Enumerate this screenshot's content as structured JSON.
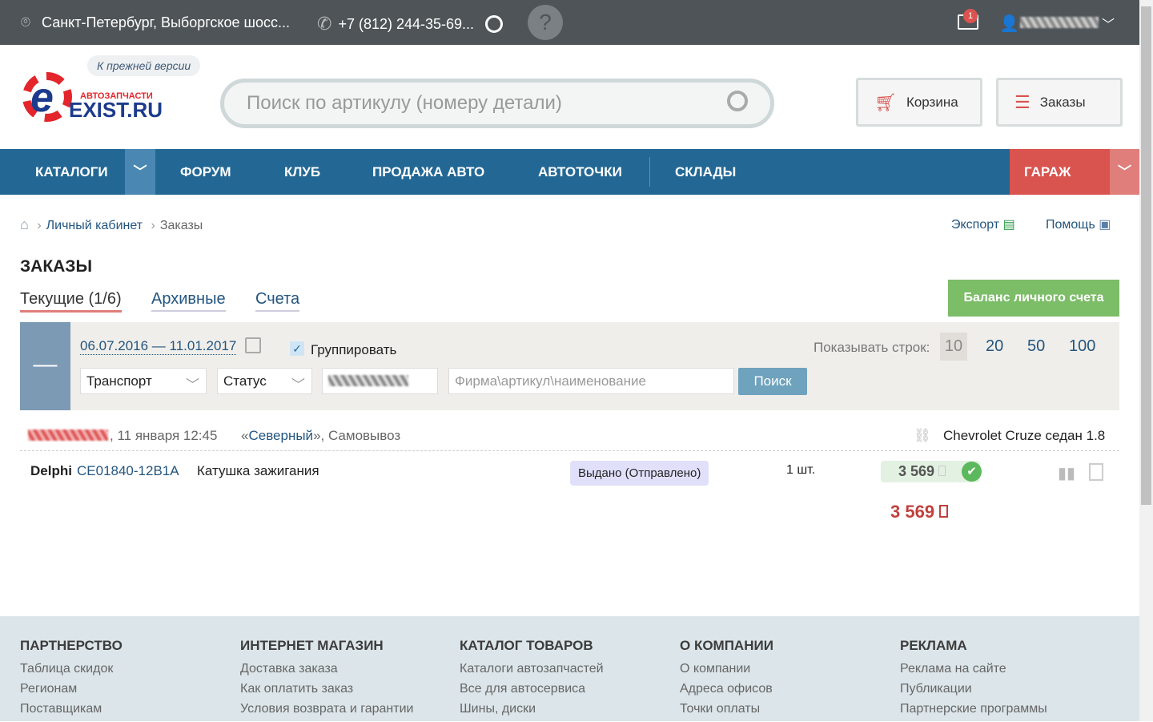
{
  "topbar": {
    "address": "Санкт-Петербург, Выборгское шосс...",
    "phone": "+7 (812) 244-35-69...",
    "help": "?",
    "mail_count": "1"
  },
  "header": {
    "prev_version": "К прежней версии",
    "logo_small": "АВТОЗАПЧАСТИ",
    "logo_big": "EXIST.RU",
    "search_placeholder": "Поиск по артикулу (номеру детали)",
    "cart": "Корзина",
    "orders": "Заказы"
  },
  "nav": [
    "КАТАЛОГИ",
    "ФОРУМ",
    "КЛУБ",
    "ПРОДАЖА АВТО",
    "АВТОТОЧКИ",
    "СКЛАДЫ",
    "ГАРАЖ"
  ],
  "breadcrumb": [
    "Личный кабинет",
    "Заказы"
  ],
  "actions": {
    "export": "Экспорт",
    "help": "Помощь"
  },
  "page": {
    "title": "ЗАКАЗЫ",
    "tabs": [
      "Текущие (1/6)",
      "Архивные",
      "Счета"
    ],
    "balance": "Баланс личного счета"
  },
  "filter": {
    "date_range": "06.07.2016 — 11.01.2017",
    "group": "Группировать",
    "rows_label": "Показывать строк:",
    "rows": [
      "10",
      "20",
      "50",
      "100"
    ],
    "transport": "Транспорт",
    "status": "Статус",
    "query_placeholder": "Фирма\\артикул\\наименование",
    "search": "Поиск"
  },
  "order": {
    "date": ", 11 января 12:45",
    "store_open": "«",
    "store": "Северный",
    "store_close": "», Самовывоз",
    "car": "Chevrolet Cruze седан 1.8",
    "item": {
      "brand": "Delphi",
      "article": "CE01840-12B1A",
      "name": "Катушка зажигания",
      "status": "Выдано (Отправлено)",
      "qty": "1 шт.",
      "price": "3 569"
    },
    "total": "3 569"
  },
  "footer": [
    {
      "title": "ПАРТНЕРСТВО",
      "links": [
        "Таблица скидок",
        "Регионам",
        "Поставщикам"
      ]
    },
    {
      "title": "ИНТЕРНЕТ МАГАЗИН",
      "links": [
        "Доставка заказа",
        "Как оплатить заказ",
        "Условия возврата и гарантии"
      ]
    },
    {
      "title": "КАТАЛОГ ТОВАРОВ",
      "links": [
        "Каталоги автозапчастей",
        "Все для автосервиса",
        "Шины, диски"
      ]
    },
    {
      "title": "О КОМПАНИИ",
      "links": [
        "О компании",
        "Адреса офисов",
        "Точки оплаты"
      ]
    },
    {
      "title": "РЕКЛАМА",
      "links": [
        "Реклама на сайте",
        "Публикации",
        "Партнерские программы"
      ]
    }
  ]
}
